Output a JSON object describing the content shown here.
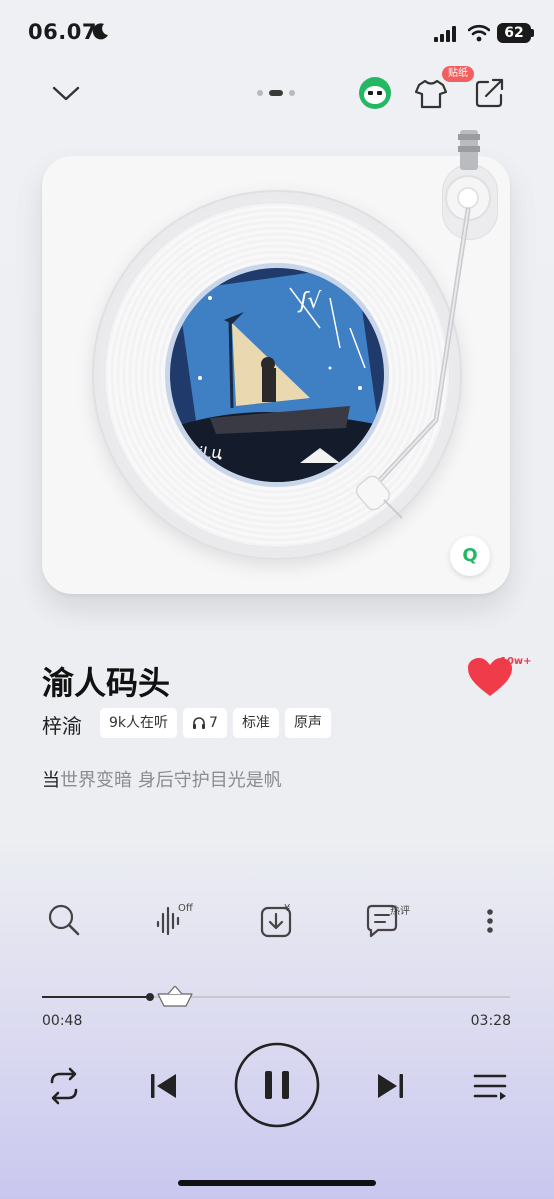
{
  "status_bar": {
    "time": "06.07",
    "battery": "62"
  },
  "top_bar": {
    "sticker_badge": "贴纸"
  },
  "player_card": {
    "q_badge": "Q"
  },
  "song": {
    "title": "渝人码头",
    "artist": "梓渝",
    "like_count": "10w+",
    "tags": [
      {
        "label": "9k人在听"
      },
      {
        "label": "7"
      },
      {
        "label": "标准"
      },
      {
        "label": "原声"
      }
    ],
    "lyric_highlight": "当",
    "lyric_rest": "世界变暗 身后守护目光是帆"
  },
  "actions": {
    "sound_effect_sup": "Off",
    "download_sup": "¥",
    "comment_sup": "热评"
  },
  "progress": {
    "current": "00:48",
    "total": "03:28",
    "fraction": 0.2308
  },
  "colors": {
    "accent_green": "#25b864",
    "heart_red": "#f03b4a",
    "badge_red": "#f25f5f",
    "cover_blue": "#3f7fc4"
  }
}
